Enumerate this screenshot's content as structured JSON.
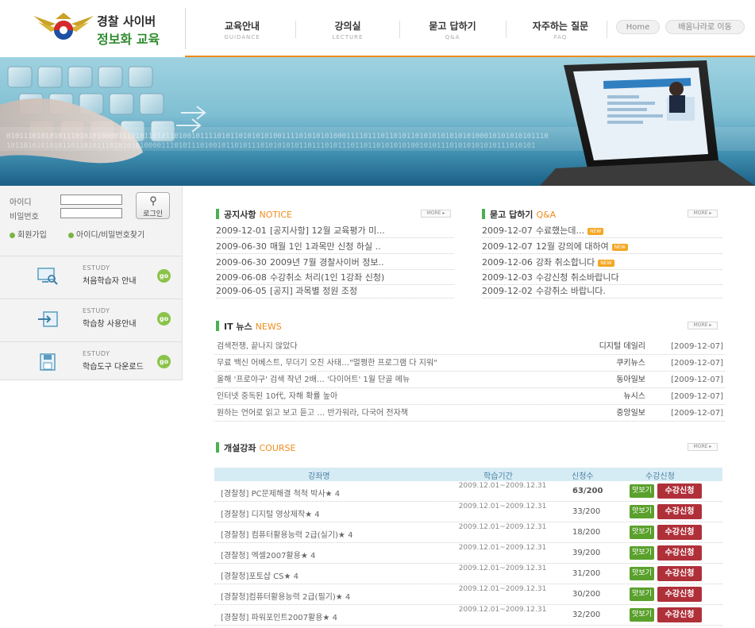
{
  "header": {
    "logo_line1": "경찰 사이버",
    "logo_line2": "정보화 교육",
    "nav": [
      {
        "label": "교육안내",
        "sub": "GUIDANCE"
      },
      {
        "label": "강의실",
        "sub": "LECTURE"
      },
      {
        "label": "묻고 답하기",
        "sub": "Q&A"
      },
      {
        "label": "자주하는 질문",
        "sub": "FAQ"
      }
    ],
    "home_label": "Home",
    "move_label": "배움나라로 이동"
  },
  "login": {
    "id_label": "아이디",
    "pw_label": "비밀번호",
    "login_button": "로그인",
    "join_link": "회원가입",
    "find_link": "아이디/비밀번호찾기"
  },
  "guides": [
    {
      "small": "ESTUDY",
      "label": "처음학습자 안내",
      "icon": "monitor-search-icon",
      "go": "go"
    },
    {
      "small": "ESTUDY",
      "label": "학습창 사용안내",
      "icon": "arrow-window-icon",
      "go": "go"
    },
    {
      "small": "ESTUDY",
      "label": "학습도구 다운로드",
      "icon": "floppy-disk-icon",
      "go": "go"
    }
  ],
  "notice": {
    "title": "공지사항",
    "title_en": "NOTICE",
    "more": "MORE ▸",
    "items": [
      {
        "date": "2009-12-01",
        "text": "[공지사항] 12월 교육평가 미..."
      },
      {
        "date": "2009-06-30",
        "text": "매월 1인 1과목만 신청 하실 .."
      },
      {
        "date": "2009-06-30",
        "text": "2009년 7월 경찰사이버 정보.."
      },
      {
        "date": "2009-06-08",
        "text": "수강취소 처리(1인 1강좌 신청)"
      },
      {
        "date": "2009-06-05",
        "text": "[공지] 과목별 정원 조정"
      }
    ]
  },
  "qna": {
    "title": "묻고 답하기",
    "title_en": "Q&A",
    "more": "MORE ▸",
    "items": [
      {
        "date": "2009-12-07",
        "text": "수료했는데...",
        "new": "NEW"
      },
      {
        "date": "2009-12-07",
        "text": "12월 강의에 대하여",
        "new": "NEW"
      },
      {
        "date": "2009-12-06",
        "text": "강좌 취소합니다",
        "new": "NEW"
      },
      {
        "date": "2009-12-03",
        "text": "수강신청 취소바랍니다",
        "new": ""
      },
      {
        "date": "2009-12-02",
        "text": "수강취소 바랍니다.",
        "new": ""
      }
    ]
  },
  "news": {
    "title": "IT 뉴스",
    "title_en": "NEWS",
    "more": "MORE ▸",
    "items": [
      {
        "headline": "검색전쟁, 끝나지 않았다",
        "source": "디지털 데일리",
        "date": "[2009-12-07]"
      },
      {
        "headline": "무료 백신 어베스트, 무더기 오진 사태…\"멀쩡한 프로그램 다 지워\"",
        "source": "쿠키뉴스",
        "date": "[2009-12-07]"
      },
      {
        "headline": "올해 '프로야구' 검색 작년 2배… '다이어트' 1월 단골 메뉴",
        "source": "동아일보",
        "date": "[2009-12-07]"
      },
      {
        "headline": "인터넷 중독된 10代, 자해 확률 높아",
        "source": "뉴시스",
        "date": "[2009-12-07]"
      },
      {
        "headline": "원하는 언어로 읽고 보고 듣고 … 반가워라, 다국어 전자책",
        "source": "중앙일보",
        "date": "[2009-12-07]"
      }
    ]
  },
  "course": {
    "title": "개설강좌",
    "title_en": "COURSE",
    "more": "MORE ▸",
    "columns": [
      "강좌명",
      "학습기간",
      "신청수",
      "수강신청"
    ],
    "preview_label": "맛보기",
    "apply_label": "수강신청",
    "rows": [
      {
        "name": "[경찰청] PC문제해결 척척 박사★ 4",
        "period": "2009.12.01~2009.12.31",
        "count": "63/200"
      },
      {
        "name": "[경찰청] 디지털 영상제작★ 4",
        "period": "2009.12.01~2009.12.31",
        "count": "33/200"
      },
      {
        "name": "[경찰청] 컴퓨터활용능력 2급(실기)★ 4",
        "period": "2009.12.01~2009.12.31",
        "count": "18/200"
      },
      {
        "name": "[경찰청] 엑셀2007활용★ 4",
        "period": "2009.12.01~2009.12.31",
        "count": "39/200"
      },
      {
        "name": "[경찰청]포토샵 CS★ 4",
        "period": "2009.12.01~2009.12.31",
        "count": "31/200"
      },
      {
        "name": "[경찰청]컴퓨터활용능력 2급(필기)★ 4",
        "period": "2009.12.01~2009.12.31",
        "count": "30/200"
      },
      {
        "name": "[경찰청] 파워포인트2007활용★ 4",
        "period": "2009.12.01~2009.12.31",
        "count": "32/200"
      }
    ]
  },
  "colors": {
    "accent_orange": "#f08c1c",
    "accent_green": "#4caf50",
    "apply_red": "#b0303a",
    "preview_green": "#5aa02c"
  }
}
